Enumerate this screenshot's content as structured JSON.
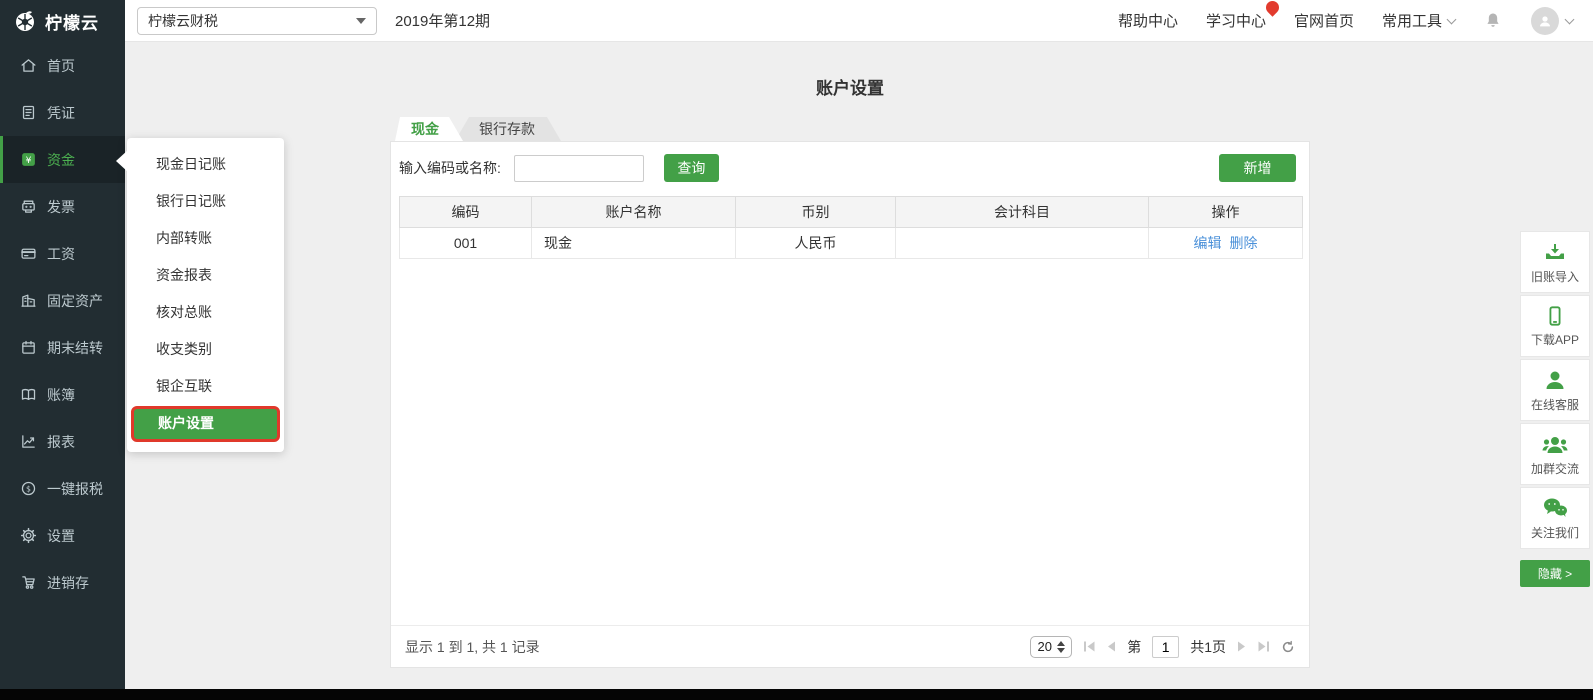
{
  "brand": {
    "name": "柠檬云"
  },
  "topbar": {
    "product": "柠檬云财税",
    "period": "2019年第12期",
    "help": "帮助中心",
    "learn": "学习中心",
    "site": "官网首页",
    "tools": "常用工具"
  },
  "sidebar": {
    "items": [
      {
        "label": "首页",
        "icon": "home-icon"
      },
      {
        "label": "凭证",
        "icon": "voucher-icon"
      },
      {
        "label": "资金",
        "icon": "funds-icon",
        "active": true
      },
      {
        "label": "发票",
        "icon": "invoice-icon"
      },
      {
        "label": "工资",
        "icon": "salary-icon"
      },
      {
        "label": "固定资产",
        "icon": "assets-icon"
      },
      {
        "label": "期末结转",
        "icon": "carryover-icon"
      },
      {
        "label": "账簿",
        "icon": "books-icon"
      },
      {
        "label": "报表",
        "icon": "reports-icon"
      },
      {
        "label": "一键报税",
        "icon": "tax-icon"
      },
      {
        "label": "设置",
        "icon": "settings-icon"
      },
      {
        "label": "进销存",
        "icon": "inventory-icon"
      }
    ]
  },
  "flyout": {
    "items": [
      "现金日记账",
      "银行日记账",
      "内部转账",
      "资金报表",
      "核对总账",
      "收支类别",
      "银企互联",
      "账户设置"
    ],
    "active_item": "账户设置"
  },
  "main": {
    "title": "账户设置",
    "tabs": [
      {
        "label": "现金",
        "active": true
      },
      {
        "label": "银行存款",
        "active": false
      }
    ],
    "search_label": "输入编码或名称:",
    "query_button": "查询",
    "add_button": "新增",
    "table": {
      "headers": [
        "编码",
        "账户名称",
        "币别",
        "会计科目",
        "操作"
      ],
      "rows": [
        {
          "code": "001",
          "name": "现金",
          "currency": "人民币",
          "subject": "",
          "edit": "编辑",
          "delete": "删除"
        }
      ]
    },
    "pagination": {
      "summary": "显示 1 到 1, 共 1 记录",
      "page_size": "20",
      "page_prefix": "第",
      "current_page": "1",
      "total_pages": "共1页"
    }
  },
  "right_toolbar": {
    "items": [
      {
        "label": "旧账导入",
        "icon": "import-icon"
      },
      {
        "label": "下载APP",
        "icon": "phone-icon"
      },
      {
        "label": "在线客服",
        "icon": "service-icon"
      },
      {
        "label": "加群交流",
        "icon": "group-icon"
      },
      {
        "label": "关注我们",
        "icon": "wechat-icon"
      }
    ],
    "hide_button": "隐藏 >"
  },
  "colors": {
    "accent": "#43a047",
    "sidebar_bg": "#222d32",
    "annotation_red": "#e0392b",
    "link_blue": "#4a90d9",
    "badge_red": "#e23b2e"
  }
}
